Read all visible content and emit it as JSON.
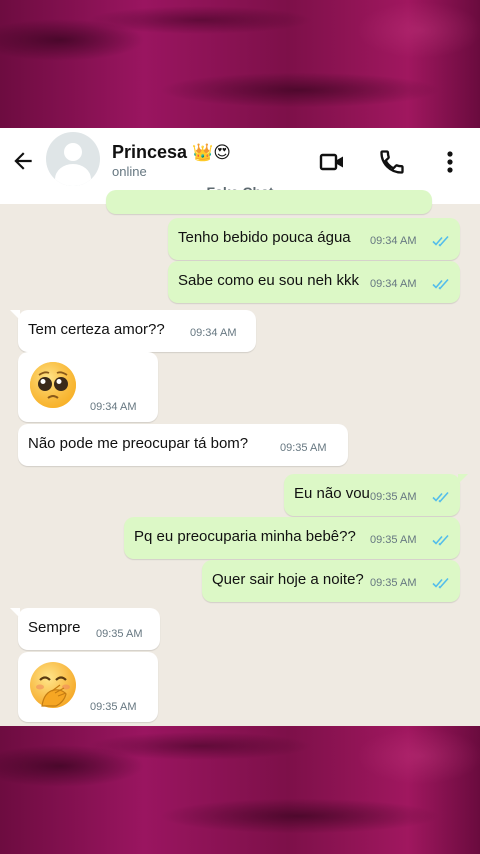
{
  "contact": {
    "name": "Princesa",
    "name_emojis": "👑😍",
    "status": "online"
  },
  "watermark": "Fake Chat",
  "header_icons": [
    "back-arrow-icon",
    "video-call-icon",
    "phone-call-icon",
    "more-options-icon"
  ],
  "colors": {
    "outgoing_bubble": "#dcf8c6",
    "incoming_bubble": "#ffffff",
    "chat_background": "#efeae2",
    "read_ticks": "#53bdeb",
    "page_background": "#7a0f48"
  },
  "messages": [
    {
      "dir": "out",
      "text": "Tenho bebido pouca água",
      "time": "09:34 AM",
      "read": true
    },
    {
      "dir": "out",
      "text": "Sabe como eu sou neh kkk",
      "time": "09:34 AM",
      "read": true
    },
    {
      "dir": "in",
      "text": "Tem certeza amor??",
      "time": "09:34 AM"
    },
    {
      "dir": "in",
      "emoji": "pleading-face-emoji",
      "time": "09:34 AM"
    },
    {
      "dir": "in",
      "text": "Não pode me preocupar tá bom?",
      "time": "09:35 AM"
    },
    {
      "dir": "out",
      "text": "Eu não vou",
      "time": "09:35 AM",
      "read": true
    },
    {
      "dir": "out",
      "text": "Pq eu preocuparia minha bebê??",
      "time": "09:35 AM",
      "read": true
    },
    {
      "dir": "out",
      "text": "Quer sair hoje a noite?",
      "time": "09:35 AM",
      "read": true
    },
    {
      "dir": "in",
      "text": "Sempre",
      "time": "09:35 AM"
    },
    {
      "dir": "in",
      "emoji": "face-with-hand-over-mouth-emoji",
      "time": "09:35 AM"
    }
  ]
}
